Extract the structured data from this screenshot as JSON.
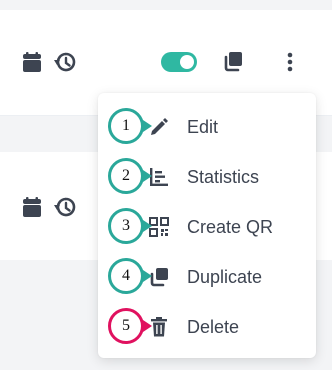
{
  "rows": [
    {
      "icons": [
        "calendar-icon",
        "history-icon"
      ],
      "toggle_on": true,
      "actions": [
        "copy-icon",
        "more-vertical-icon"
      ]
    },
    {
      "icons": [
        "calendar-icon",
        "history-icon"
      ]
    }
  ],
  "colors": {
    "accent": "#2fb8a2",
    "badge_teal": "#2aa89a",
    "badge_red": "#e0115f",
    "icon_dark": "#3d4451",
    "menu_text": "#3d4451",
    "page_bg": "#f3f4f6"
  },
  "menu": {
    "items": [
      {
        "badge": "1",
        "label": "Edit",
        "icon": "pencil-icon"
      },
      {
        "badge": "2",
        "label": "Statistics",
        "icon": "chart-icon"
      },
      {
        "badge": "3",
        "label": "Create QR",
        "icon": "qr-code-icon"
      },
      {
        "badge": "4",
        "label": "Duplicate",
        "icon": "duplicate-icon"
      },
      {
        "badge": "5",
        "label": "Delete",
        "icon": "trash-icon"
      }
    ]
  }
}
